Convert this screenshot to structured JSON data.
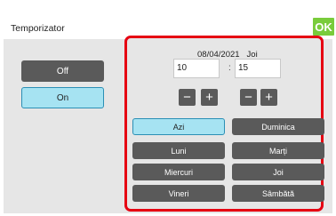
{
  "header": {
    "title": "Temporizator",
    "ok_label": "OK"
  },
  "mode": {
    "off_label": "Off",
    "on_label": "On",
    "selected": "On"
  },
  "schedule": {
    "date": "08/04/2021",
    "weekday": "Joi",
    "hours_value": "10",
    "separator": ":",
    "minutes_value": "15",
    "minus_symbol": "−",
    "plus_symbol": "+"
  },
  "days": {
    "items": [
      "Azi",
      "Duminica",
      "Luni",
      "Marți",
      "Miercuri",
      "Joi",
      "Vineri",
      "Sâmbătă"
    ],
    "selected": "Azi"
  },
  "colors": {
    "ok_green": "#79cc3b",
    "highlight_red": "#e60012",
    "selected_fill": "#a6e3f2",
    "selected_border": "#2b8fb5",
    "button_dark": "#5a5a5a"
  }
}
